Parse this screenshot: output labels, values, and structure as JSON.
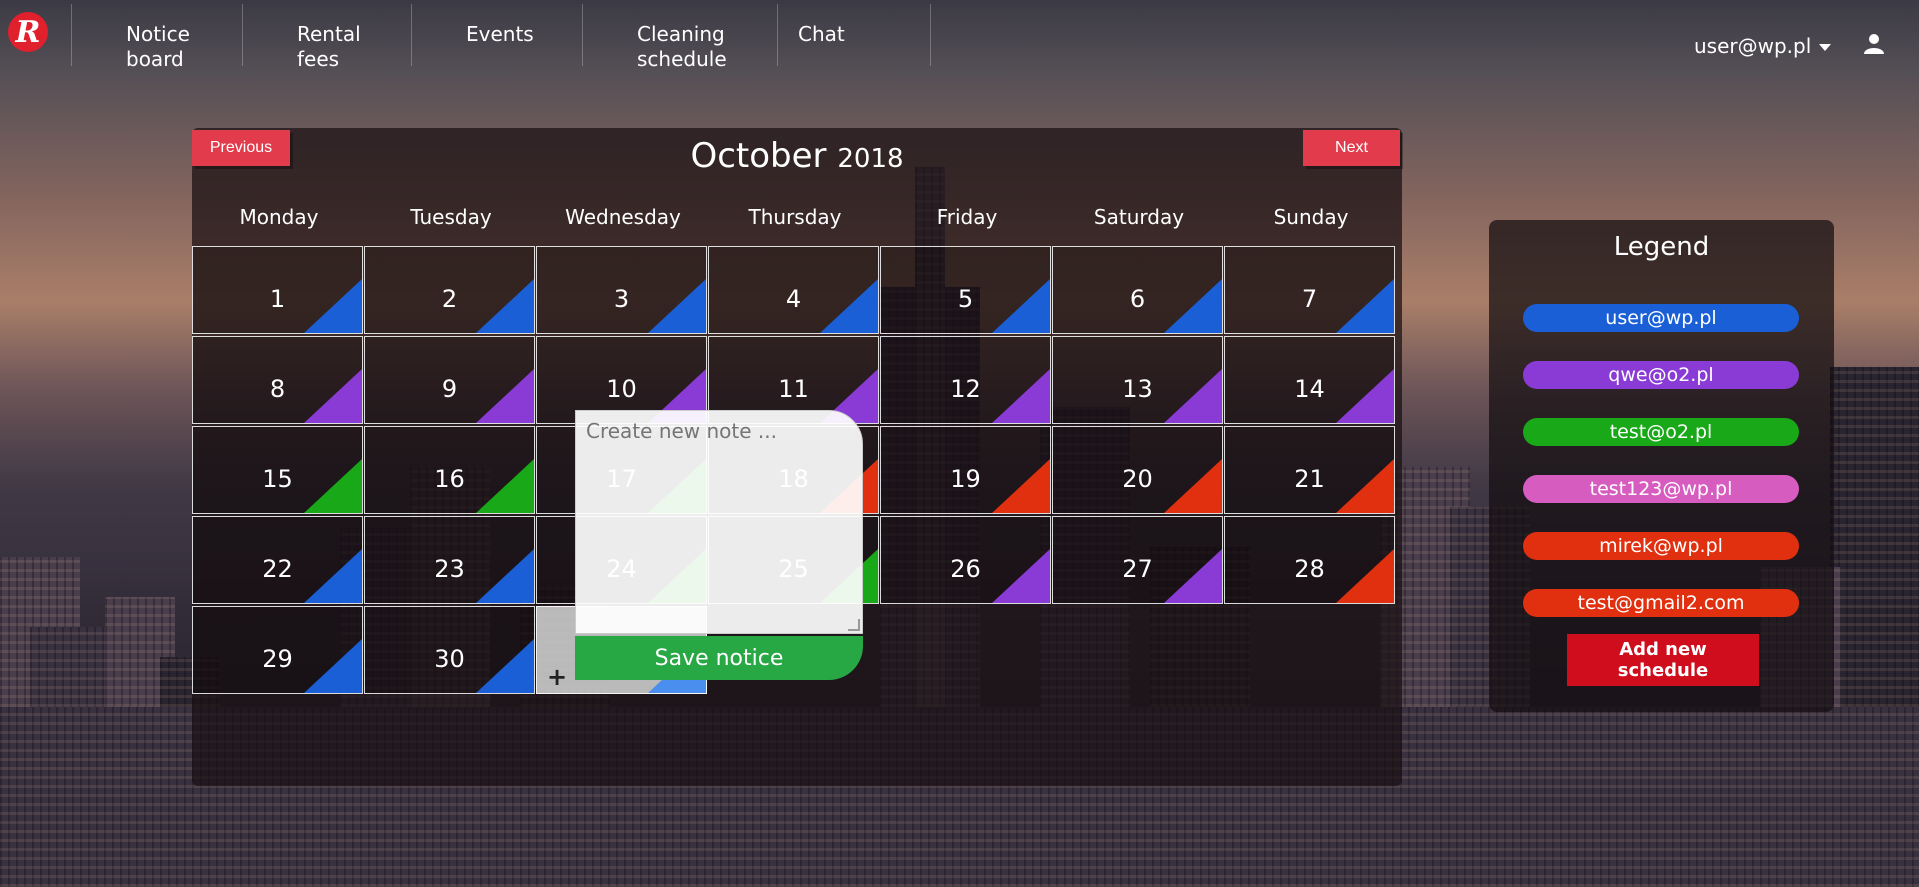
{
  "nav": {
    "logo_letter": "R",
    "items": [
      {
        "line1": "Notice",
        "line2": "board"
      },
      {
        "line1": "Rental",
        "line2": "fees"
      },
      {
        "line1": "Events",
        "line2": ""
      },
      {
        "line1": "Cleaning",
        "line2": "schedule"
      },
      {
        "line1": "Chat",
        "line2": ""
      }
    ],
    "user": "user@wp.pl",
    "user_icon": "user-icon"
  },
  "calendar": {
    "prev_label": "Previous",
    "next_label": "Next",
    "month": "October",
    "year": "2018",
    "weekdays": [
      "Monday",
      "Tuesday",
      "Wednesday",
      "Thursday",
      "Friday",
      "Saturday",
      "Sunday"
    ],
    "days": [
      "1",
      "2",
      "3",
      "4",
      "5",
      "6",
      "7",
      "8",
      "9",
      "10",
      "11",
      "12",
      "13",
      "14",
      "15",
      "16",
      "17",
      "18",
      "19",
      "20",
      "21",
      "22",
      "23",
      "24",
      "25",
      "26",
      "27",
      "28",
      "29",
      "30"
    ],
    "day_colors": [
      "#1a5fd6",
      "#1a5fd6",
      "#1a5fd6",
      "#1a5fd6",
      "#1a5fd6",
      "#1a5fd6",
      "#1a5fd6",
      "#8a3bd6",
      "#8a3bd6",
      "#8a3bd6",
      "#8a3bd6",
      "#8a3bd6",
      "#8a3bd6",
      "#8a3bd6",
      "#18a818",
      "#18a818",
      "#18a818",
      "#e0300f",
      "#e0300f",
      "#e0300f",
      "#e0300f",
      "#1a5fd6",
      "#1a5fd6",
      "#18a818",
      "#18a818",
      "#8a3bd6",
      "#8a3bd6",
      "#e0300f",
      "#1a5fd6",
      "#1a5fd6"
    ],
    "add_day_symbol": "+"
  },
  "note": {
    "placeholder": "Create new note ...",
    "save_label": "Save notice"
  },
  "legend": {
    "title": "Legend",
    "entries": [
      {
        "label": "user@wp.pl",
        "color": "#1a5fd6"
      },
      {
        "label": "qwe@o2.pl",
        "color": "#8a3bd6"
      },
      {
        "label": "test@o2.pl",
        "color": "#18a818"
      },
      {
        "label": "test123@wp.pl",
        "color": "#d75cc0"
      },
      {
        "label": "mirek@wp.pl",
        "color": "#e0300f"
      },
      {
        "label": "test@gmail2.com",
        "color": "#e0300f"
      }
    ],
    "add_label": "Add new schedule"
  }
}
